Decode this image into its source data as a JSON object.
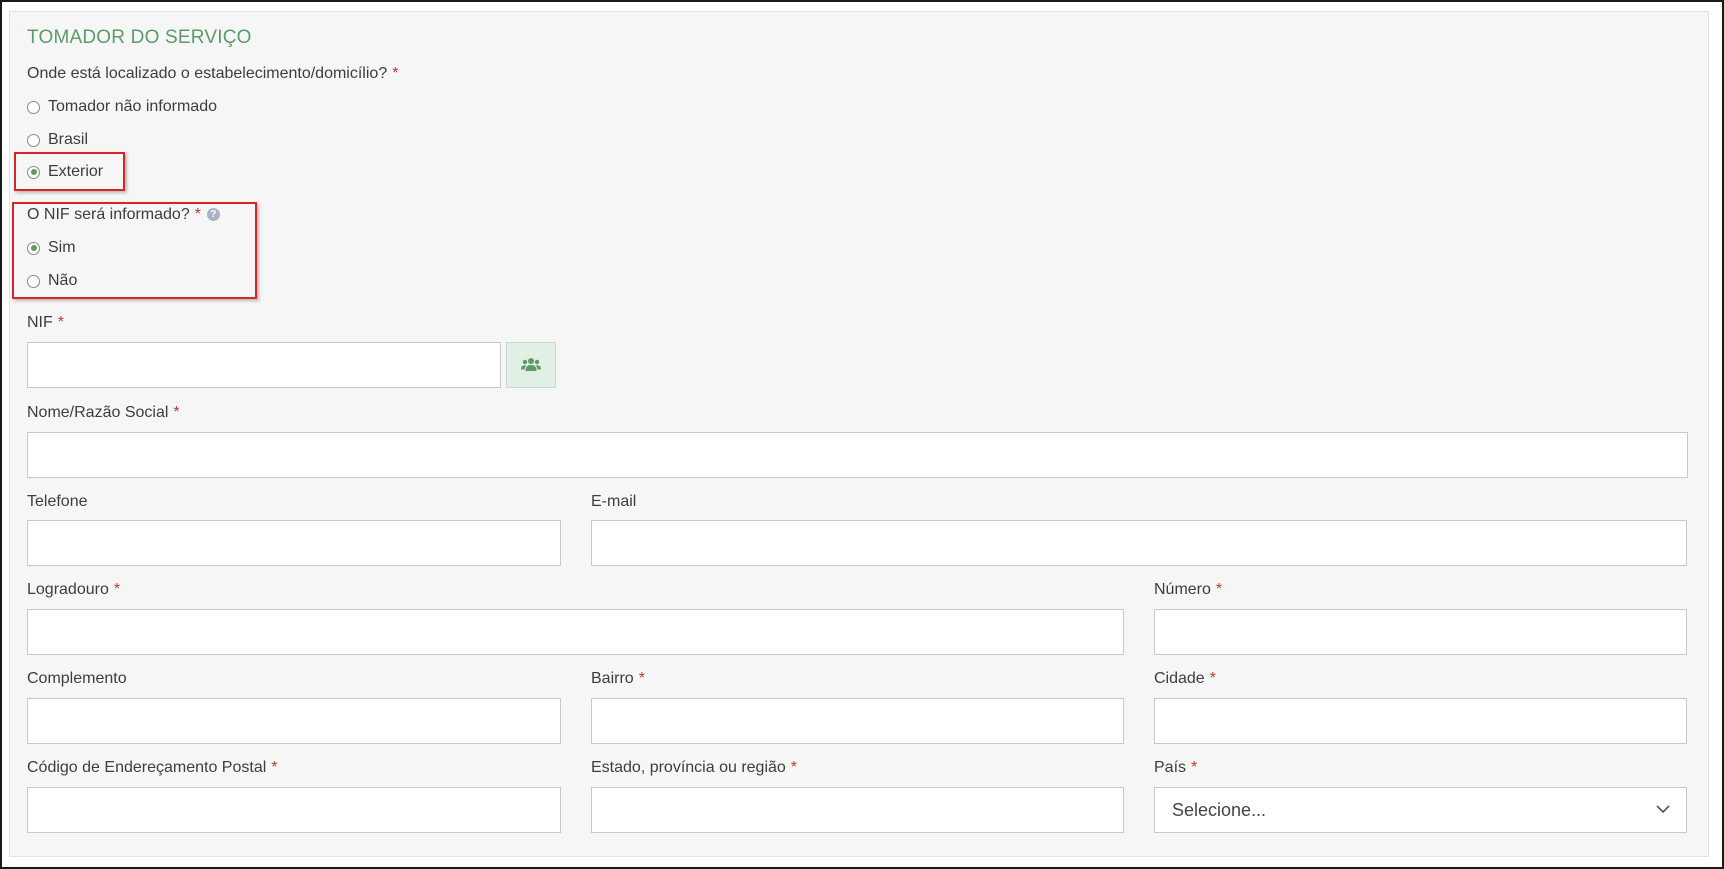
{
  "section": {
    "title": "TOMADOR DO SERVIÇO"
  },
  "location": {
    "question": "Onde está localizado o estabelecimento/domicílio?",
    "required_mark": "*",
    "options": [
      {
        "label": "Tomador não informado",
        "checked": false
      },
      {
        "label": "Brasil",
        "checked": false
      },
      {
        "label": "Exterior",
        "checked": true
      }
    ]
  },
  "nif_question": {
    "question": "O NIF será informado?",
    "required_mark": "*",
    "help_icon": "question-circle-icon",
    "options": [
      {
        "label": "Sim",
        "checked": true
      },
      {
        "label": "Não",
        "checked": false
      }
    ]
  },
  "fields": {
    "nif": {
      "label": "NIF",
      "required_mark": "*",
      "value": "",
      "button_icon": "users-icon"
    },
    "nome": {
      "label": "Nome/Razão Social",
      "required_mark": "*",
      "value": ""
    },
    "telefone": {
      "label": "Telefone",
      "value": ""
    },
    "email": {
      "label": "E-mail",
      "value": ""
    },
    "logradouro": {
      "label": "Logradouro",
      "required_mark": "*",
      "value": ""
    },
    "numero": {
      "label": "Número",
      "required_mark": "*",
      "value": ""
    },
    "complemento": {
      "label": "Complemento",
      "value": ""
    },
    "bairro": {
      "label": "Bairro",
      "required_mark": "*",
      "value": ""
    },
    "cidade": {
      "label": "Cidade",
      "required_mark": "*",
      "value": ""
    },
    "cep": {
      "label": "Código de Endereçamento Postal",
      "required_mark": "*",
      "value": ""
    },
    "estado": {
      "label": "Estado, província ou região",
      "required_mark": "*",
      "value": ""
    },
    "pais": {
      "label": "País",
      "required_mark": "*",
      "selected": "Selecione..."
    }
  },
  "colors": {
    "accent": "#5d9a68",
    "required": "#c0392b",
    "highlight": "#d72424",
    "panel_bg": "#f6f6f6"
  }
}
